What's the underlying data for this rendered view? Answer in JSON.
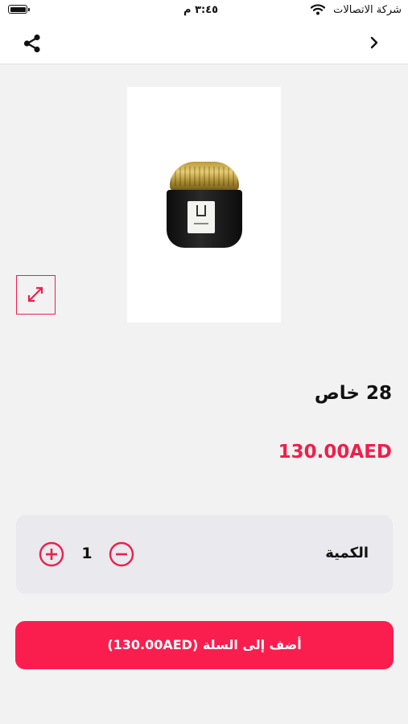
{
  "status_bar": {
    "time": "٣:٤٥ م",
    "carrier": "شركة الاتصالات",
    "battery_icon": "battery-icon",
    "wifi_icon": "wifi-icon"
  },
  "nav": {
    "share_icon": "share-icon",
    "back_icon": "chevron-right-icon"
  },
  "product": {
    "name": "28 خاص",
    "price": "130.00AED",
    "image_alt": "product-jar-image",
    "expand_icon": "expand-icon"
  },
  "quantity": {
    "label": "الكمية",
    "value": "1",
    "increase_icon": "plus-circle-icon",
    "decrease_icon": "minus-circle-icon"
  },
  "cart": {
    "button_label": "أضف إلى السلة (130.00AED)"
  },
  "colors": {
    "accent": "#ee1f4c",
    "button": "#fa1e4e",
    "background": "#f2f2f2",
    "card": "#e9e9ee"
  }
}
